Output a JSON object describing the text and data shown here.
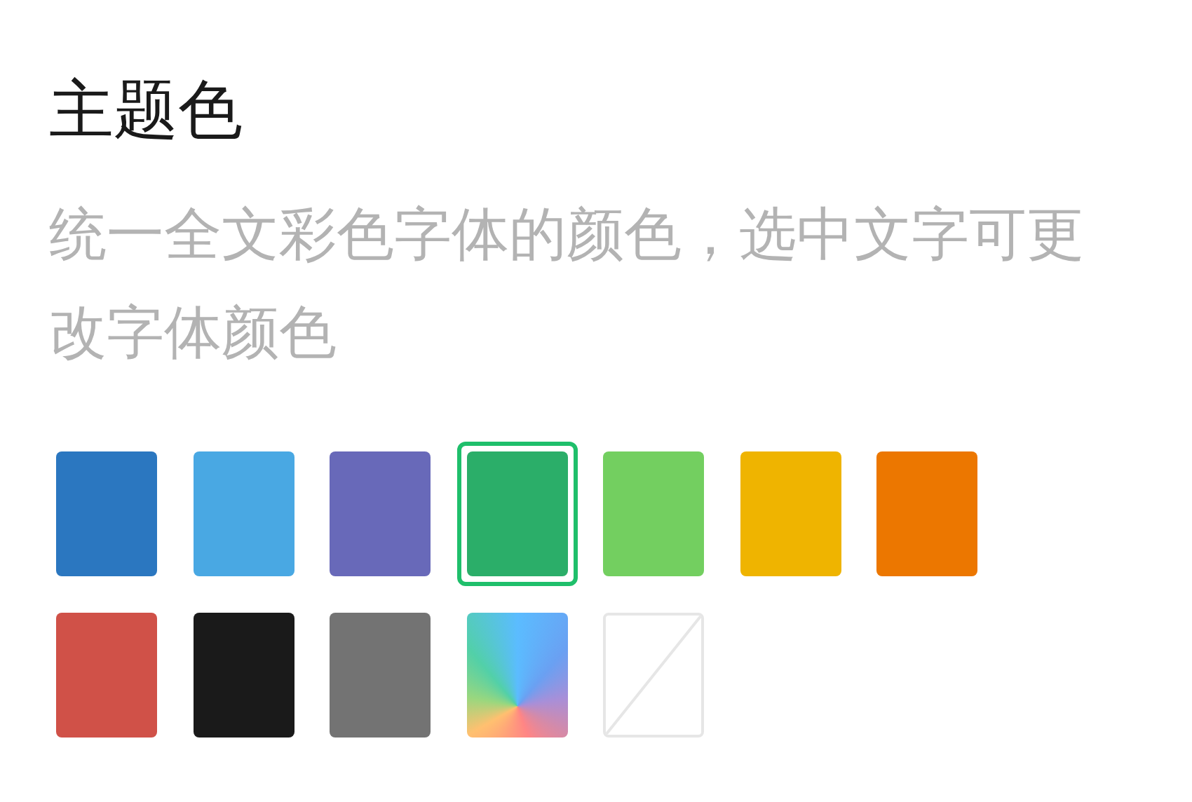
{
  "title": "主题色",
  "description": "统一全文彩色字体的颜色，选中文字可更改字体颜色",
  "swatches": [
    {
      "kind": "solid",
      "color": "#2b77c0",
      "selected": false
    },
    {
      "kind": "solid",
      "color": "#49a8e3",
      "selected": false
    },
    {
      "kind": "solid",
      "color": "#6869b9",
      "selected": false
    },
    {
      "kind": "solid",
      "color": "#2bae69",
      "selected": true
    },
    {
      "kind": "solid",
      "color": "#73cf60",
      "selected": false
    },
    {
      "kind": "solid",
      "color": "#efb400",
      "selected": false
    },
    {
      "kind": "solid",
      "color": "#ec7700",
      "selected": false
    },
    {
      "kind": "solid",
      "color": "#d05148",
      "selected": false
    },
    {
      "kind": "solid",
      "color": "#1a1a1a",
      "selected": false
    },
    {
      "kind": "solid",
      "color": "#737373",
      "selected": false
    },
    {
      "kind": "gradient",
      "selected": false
    },
    {
      "kind": "none",
      "selected": false
    }
  ]
}
